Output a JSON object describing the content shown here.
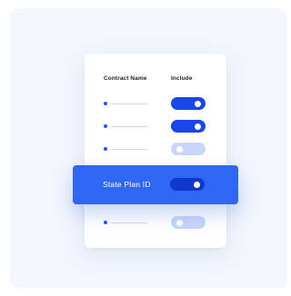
{
  "table": {
    "header": {
      "name_label": "Contract Name",
      "include_label": "Include"
    },
    "rows": [
      {
        "include": true
      },
      {
        "include": true
      },
      {
        "include": false
      },
      {
        "include": false
      }
    ],
    "highlighted_row": {
      "label": "State Plan ID",
      "include": true
    }
  },
  "colors": {
    "accent": "#1946e6",
    "highlight": "#2f66f2",
    "toggle_off": "#c9d6f9",
    "background_panel": "#f3f6fd"
  }
}
